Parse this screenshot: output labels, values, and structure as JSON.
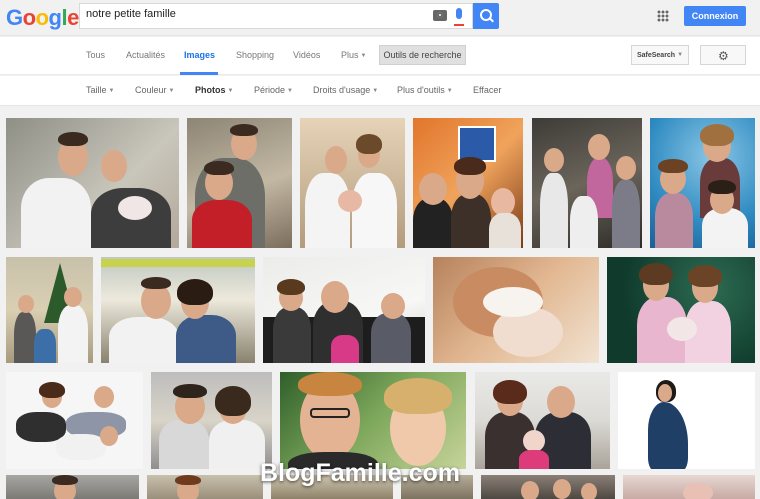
{
  "logo_text": "Google",
  "search": {
    "value": "notre petite famille",
    "placeholder": ""
  },
  "header": {
    "connexion_label": "Connexion"
  },
  "nav": {
    "tabs": [
      {
        "label": "Tous"
      },
      {
        "label": "Actualités"
      },
      {
        "label": "Images",
        "active": true
      },
      {
        "label": "Shopping"
      },
      {
        "label": "Vidéos"
      },
      {
        "label": "Plus"
      }
    ],
    "tools_label": "Outils de recherche",
    "safesearch_label": "SafeSearch"
  },
  "filters": [
    {
      "label": "Taille"
    },
    {
      "label": "Couleur"
    },
    {
      "label": "Photos",
      "selected": true
    },
    {
      "label": "Période"
    },
    {
      "label": "Droits d'usage"
    },
    {
      "label": "Plus d'outils"
    },
    {
      "label": "Effacer"
    }
  ],
  "watermark": "BlogFamille.com",
  "colors": {
    "accent": "#4285f4",
    "active_tab": "#1a73e8"
  },
  "icons": [
    "camera-icon",
    "microphone-icon",
    "search-icon",
    "apps-grid-icon",
    "gear-icon",
    "caret-down-icon"
  ]
}
